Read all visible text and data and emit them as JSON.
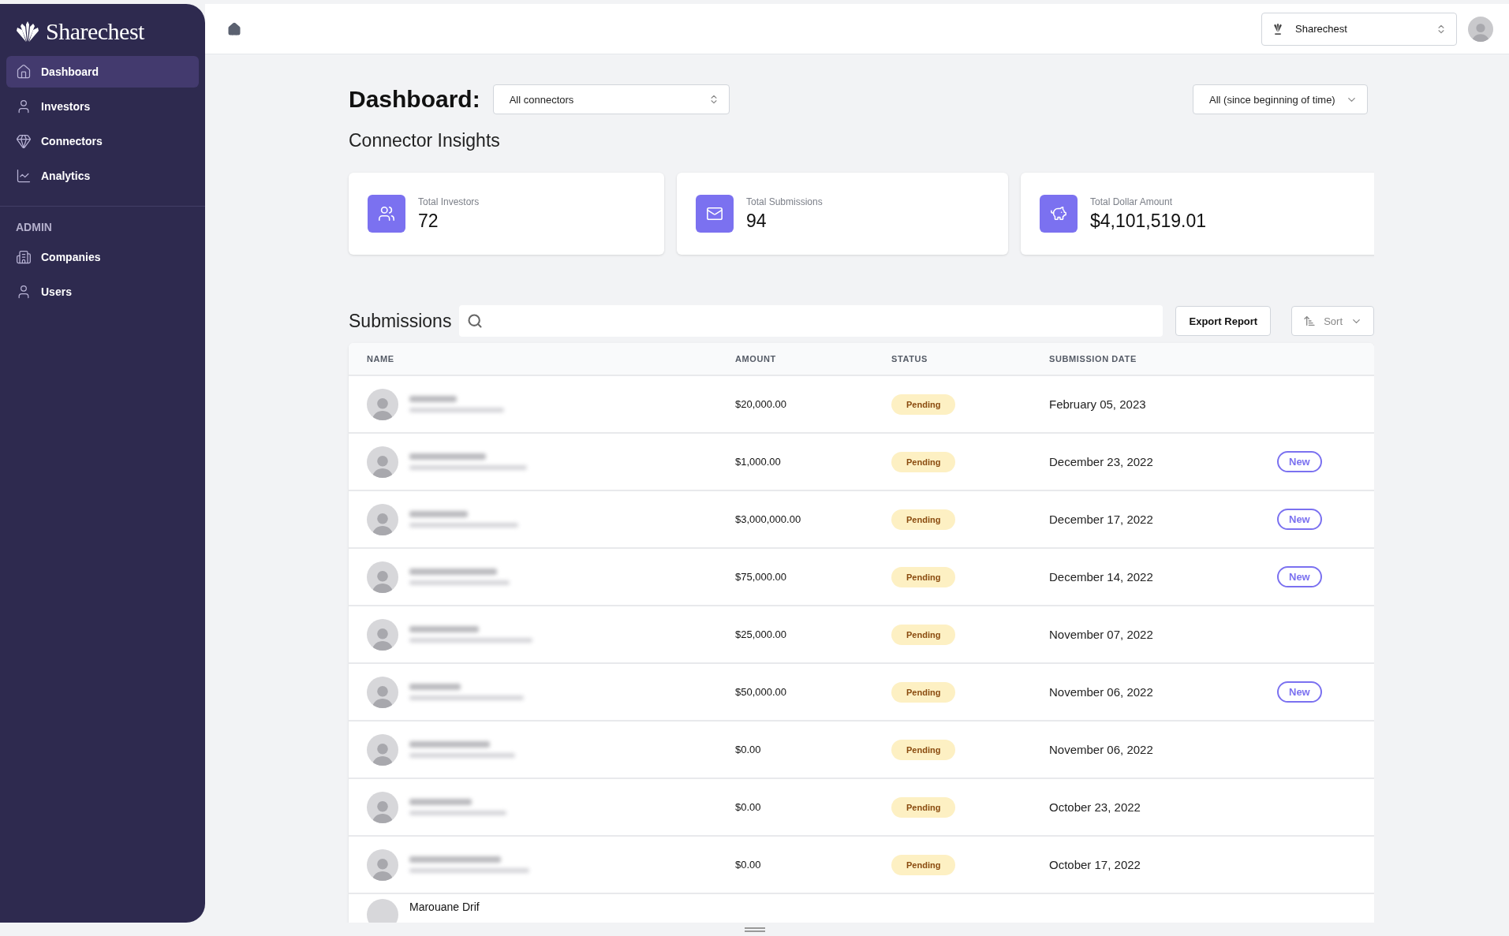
{
  "sidebar": {
    "logo": "Sharechest",
    "items": [
      {
        "label": "Dashboard",
        "selected": true
      },
      {
        "label": "Investors",
        "selected": false
      },
      {
        "label": "Connectors",
        "selected": false
      },
      {
        "label": "Analytics",
        "selected": false
      }
    ],
    "admin_label": "ADMIN",
    "admin_items": [
      {
        "label": "Companies",
        "selected": false
      },
      {
        "label": "Users",
        "selected": false
      }
    ]
  },
  "topbar": {
    "company": "Sharechest"
  },
  "header": {
    "title": "Dashboard:",
    "connector_select": "All connectors",
    "period_select": "All (since beginning of time)"
  },
  "insights": {
    "title": "Connector Insights",
    "cards": [
      {
        "label": "Total Investors",
        "value": "72"
      },
      {
        "label": "Total Submissions",
        "value": "94"
      },
      {
        "label": "Total Dollar Amount",
        "value": "$4,101,519.01"
      }
    ]
  },
  "submissions": {
    "title": "Submissions",
    "export": "Export Report",
    "sort": "Sort",
    "columns": [
      "NAME",
      "AMOUNT",
      "STATUS",
      "SUBMISSION DATE"
    ],
    "rows": [
      {
        "amount": "$20,000.00",
        "status": "Pending",
        "date": "February 05, 2023"
      },
      {
        "amount": "$1,000.00",
        "status": "Pending",
        "date": "December 23, 2022",
        "badge": "New"
      },
      {
        "amount": "$3,000,000.00",
        "status": "Pending",
        "date": "December 17, 2022",
        "badge": "New"
      },
      {
        "amount": "$75,000.00",
        "status": "Pending",
        "date": "December 14, 2022",
        "badge": "New"
      },
      {
        "amount": "$25,000.00",
        "status": "Pending",
        "date": "November 07, 2022"
      },
      {
        "amount": "$50,000.00",
        "status": "Pending",
        "date": "November 06, 2022",
        "badge": "New"
      },
      {
        "amount": "$0.00",
        "status": "Pending",
        "date": "November 06, 2022"
      },
      {
        "amount": "$0.00",
        "status": "Pending",
        "date": "October 23, 2022"
      },
      {
        "amount": "$0.00",
        "status": "Pending",
        "date": "October 17, 2022"
      },
      {
        "name": "Marouane Drif"
      }
    ]
  }
}
